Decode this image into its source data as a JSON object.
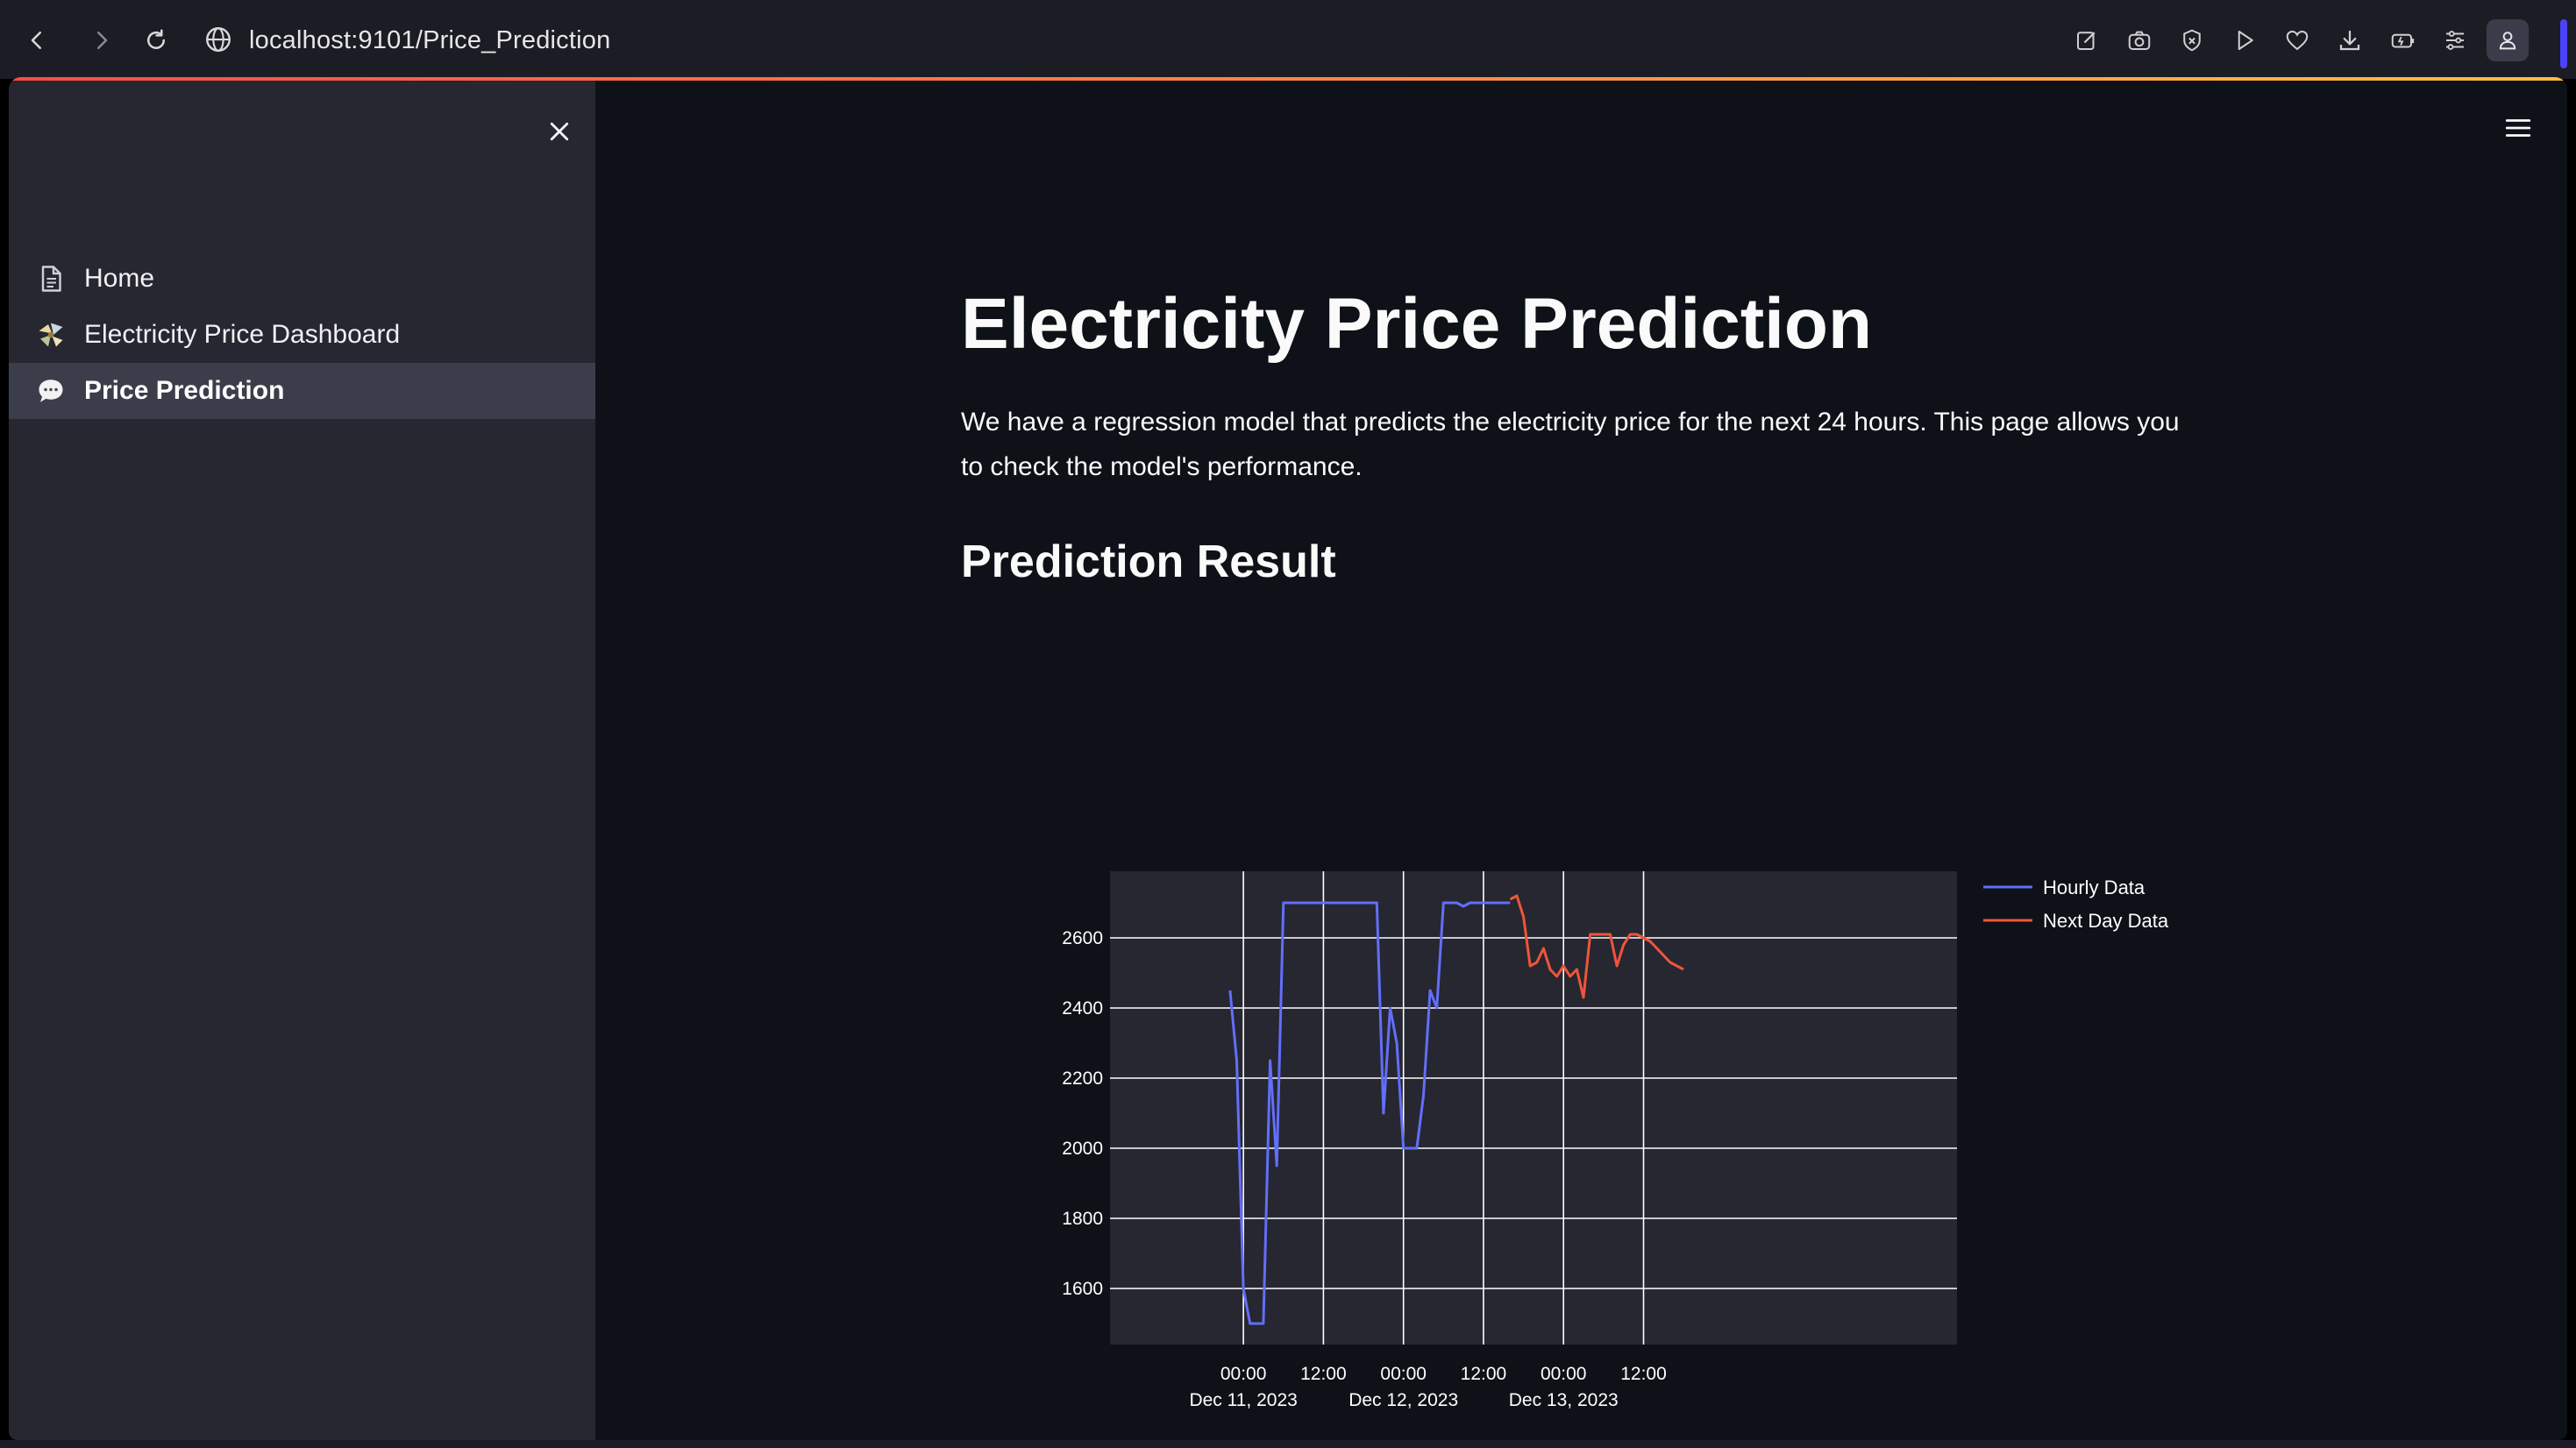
{
  "browser": {
    "url": "localhost:9101/Price_Prediction",
    "nav_icons": [
      "back-icon",
      "forward-icon",
      "reload-icon"
    ],
    "toolbar_icons": [
      "edit-icon",
      "camera-icon",
      "shield-icon",
      "play-icon",
      "heart-icon",
      "download-icon",
      "battery-icon",
      "sliders-icon",
      "profile-icon"
    ]
  },
  "sidebar": {
    "items": [
      {
        "label": "Home",
        "icon": "document-icon",
        "active": false
      },
      {
        "label": "Electricity Price Dashboard",
        "icon": "dashboard-emoji-icon",
        "active": false
      },
      {
        "label": "Price Prediction",
        "icon": "speech-bubble-icon",
        "active": true
      }
    ]
  },
  "main": {
    "title": "Electricity Price Prediction",
    "description": "We have a regression model that predicts the electricity price for the next 24 hours. This page allows you to check the model's performance.",
    "section_title": "Prediction Result"
  },
  "colors": {
    "accent_gradient": [
      "#ff4b4b",
      "#ffbd45"
    ],
    "hourly_series": "#636efa",
    "next_day_series": "#ef553b",
    "plot_background": "#262730"
  },
  "chart_data": {
    "type": "line",
    "title": "",
    "xlabel": "",
    "ylabel": "",
    "x_unit": "hours from Dec 11, 2023 00:00",
    "xlim_hours": [
      -20,
      107
    ],
    "ylim": [
      1440,
      2790
    ],
    "y_ticks": [
      1600,
      1800,
      2000,
      2200,
      2400,
      2600
    ],
    "x_ticks": [
      {
        "h": 0,
        "label": "00:00",
        "sub": "Dec 11, 2023"
      },
      {
        "h": 12,
        "label": "12:00",
        "sub": ""
      },
      {
        "h": 24,
        "label": "00:00",
        "sub": "Dec 12, 2023"
      },
      {
        "h": 36,
        "label": "12:00",
        "sub": ""
      },
      {
        "h": 48,
        "label": "00:00",
        "sub": "Dec 13, 2023"
      },
      {
        "h": 60,
        "label": "12:00",
        "sub": ""
      }
    ],
    "grid": true,
    "legend_position": "right",
    "series": [
      {
        "name": "Hourly Data",
        "x": [
          -2,
          -1,
          0,
          1,
          2,
          3,
          4,
          5,
          6,
          7,
          8,
          9,
          10,
          11,
          12,
          13,
          14,
          15,
          16,
          17,
          18,
          19,
          20,
          21,
          22,
          23,
          24,
          25,
          26,
          27,
          28,
          29,
          30,
          31,
          32,
          33,
          34,
          35,
          36,
          37,
          38,
          39,
          40
        ],
        "values": [
          2450,
          2250,
          1600,
          1500,
          1500,
          1500,
          2250,
          1950,
          2700,
          2700,
          2700,
          2700,
          2700,
          2700,
          2700,
          2700,
          2700,
          2700,
          2700,
          2700,
          2700,
          2700,
          2700,
          2100,
          2400,
          2300,
          2000,
          2000,
          2000,
          2150,
          2450,
          2400,
          2700,
          2700,
          2700,
          2690,
          2700,
          2700,
          2700,
          2700,
          2700,
          2700,
          2700
        ]
      },
      {
        "name": "Next Day Data",
        "x": [
          40,
          41,
          42,
          43,
          44,
          45,
          46,
          47,
          48,
          49,
          50,
          51,
          52,
          53,
          54,
          55,
          56,
          57,
          58,
          59,
          60,
          61,
          62,
          63,
          64,
          65,
          66
        ],
        "values": [
          2710,
          2720,
          2660,
          2520,
          2530,
          2570,
          2510,
          2490,
          2520,
          2490,
          2510,
          2430,
          2610,
          2610,
          2610,
          2610,
          2520,
          2580,
          2610,
          2610,
          2600,
          2590,
          2570,
          2550,
          2530,
          2520,
          2510
        ]
      }
    ]
  }
}
